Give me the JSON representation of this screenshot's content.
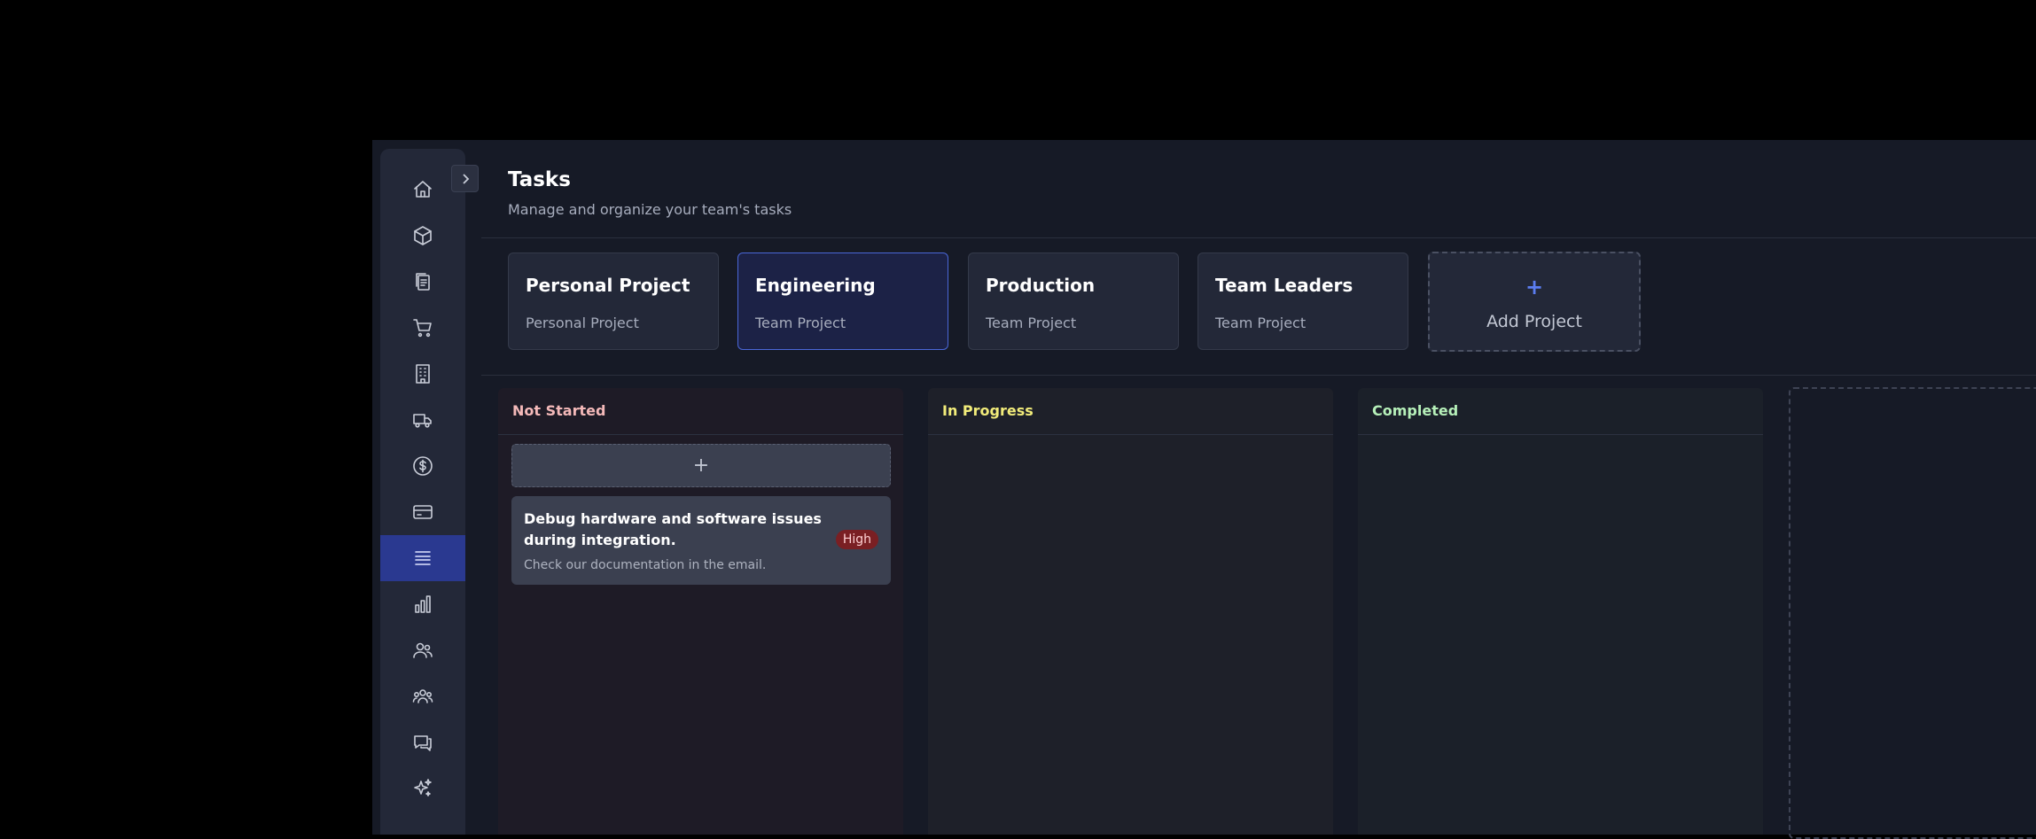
{
  "header": {
    "title": "Tasks",
    "subtitle": "Manage and organize your team's tasks"
  },
  "sidebar": {
    "items": [
      {
        "icon": "home-icon"
      },
      {
        "icon": "cube-icon"
      },
      {
        "icon": "clipboard-icon"
      },
      {
        "icon": "cart-icon"
      },
      {
        "icon": "building-icon"
      },
      {
        "icon": "truck-icon"
      },
      {
        "icon": "dollar-icon"
      },
      {
        "icon": "credit-card-icon"
      },
      {
        "icon": "list-icon",
        "active": true
      },
      {
        "icon": "bar-chart-icon"
      },
      {
        "icon": "users-icon"
      },
      {
        "icon": "team-icon"
      },
      {
        "icon": "chat-icon"
      },
      {
        "icon": "sparkle-icon"
      }
    ]
  },
  "projects": [
    {
      "name": "Personal Project",
      "type": "Personal Project"
    },
    {
      "name": "Engineering",
      "type": "Team Project",
      "active": true
    },
    {
      "name": "Production",
      "type": "Team Project"
    },
    {
      "name": "Team Leaders",
      "type": "Team Project"
    }
  ],
  "add_project": {
    "icon": "+",
    "label": "Add Project"
  },
  "columns": [
    {
      "title": "Not Started",
      "color": "#f4b9b9"
    },
    {
      "title": "In Progress",
      "color": "#f2ec7a"
    },
    {
      "title": "Completed",
      "color": "#b6f0b9"
    }
  ],
  "add_task": {
    "icon": "+"
  },
  "task": {
    "title": "Debug hardware and software issues during integration.",
    "description": "Check our documentation in the email.",
    "priority": "High"
  },
  "colors": {
    "accent": "#2a3990",
    "priority_high": "#7a1f23"
  }
}
